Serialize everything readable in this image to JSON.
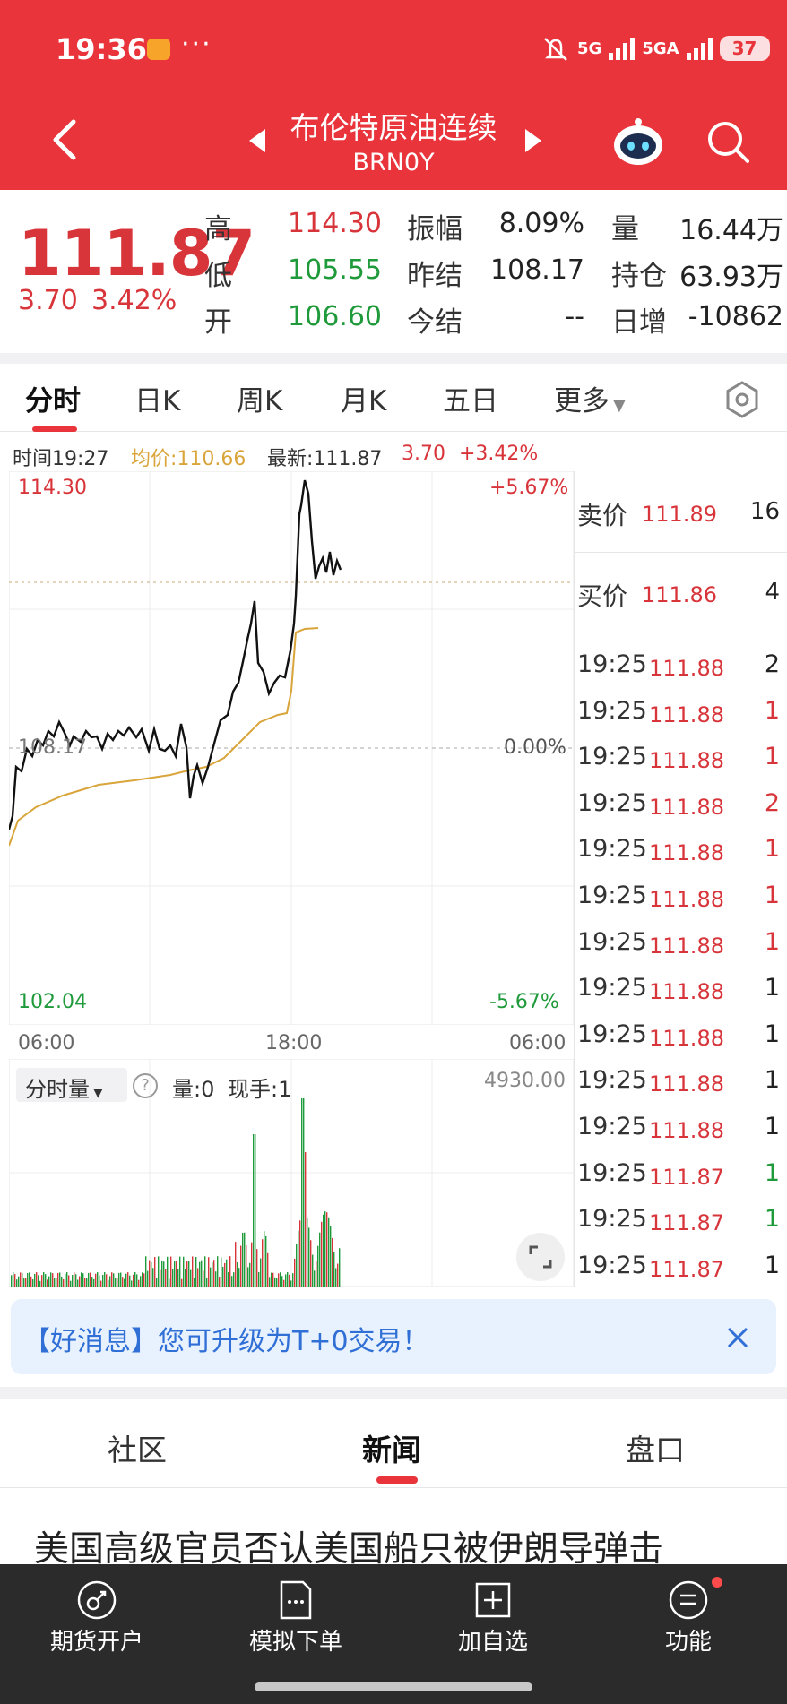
{
  "status_bar": {
    "time": "19:36",
    "dots": "···",
    "net1": "5G",
    "net2": "5GA",
    "battery": "37"
  },
  "header": {
    "title": "布伦特原油连续",
    "code": "BRN0Y"
  },
  "quote": {
    "last": "111.87",
    "change": "3.70",
    "change_pct": "3.42%",
    "high_label": "高",
    "high": "114.30",
    "low_label": "低",
    "low": "105.55",
    "open_label": "开",
    "open": "106.60",
    "amp_label": "振幅",
    "amp": "8.09%",
    "prev_label": "昨结",
    "prev": "108.17",
    "today_label": "今结",
    "today": "--",
    "vol_label": "量",
    "vol": "16.44万",
    "oi_label": "持仓",
    "oi": "63.93万",
    "inc_label": "日增",
    "inc": "-10862"
  },
  "tabs": [
    "分时",
    "日K",
    "周K",
    "月K",
    "五日",
    "更多"
  ],
  "info": {
    "time": "时间19:27",
    "avg": "均价:110.66",
    "latest": "最新:111.87",
    "chg": "3.70",
    "pct": "+3.42%"
  },
  "chart": {
    "top_price": "114.30",
    "mid_price": "108.17",
    "bottom_price": "102.04",
    "top_pct": "+5.67%",
    "mid_pct": "0.00%",
    "bottom_pct": "-5.67%",
    "time_labels": [
      "06:00",
      "18:00",
      "06:00"
    ],
    "vol_selector": "分时量",
    "help": "?",
    "vol_qty": "量:0",
    "vol_curr": "现手:1",
    "vol_max": "4930.00"
  },
  "order_book": {
    "ask_label": "卖价",
    "ask_price": "111.89",
    "ask_vol": "16",
    "bid_label": "买价",
    "bid_price": "111.86",
    "bid_vol": "4",
    "trades": [
      {
        "time": "19:25",
        "price": "111.88",
        "vol": "2",
        "color": "dark"
      },
      {
        "time": "19:25",
        "price": "111.88",
        "vol": "1",
        "color": "red"
      },
      {
        "time": "19:25",
        "price": "111.88",
        "vol": "1",
        "color": "red"
      },
      {
        "time": "19:25",
        "price": "111.88",
        "vol": "2",
        "color": "red"
      },
      {
        "time": "19:25",
        "price": "111.88",
        "vol": "1",
        "color": "red"
      },
      {
        "time": "19:25",
        "price": "111.88",
        "vol": "1",
        "color": "red"
      },
      {
        "time": "19:25",
        "price": "111.88",
        "vol": "1",
        "color": "red"
      },
      {
        "time": "19:25",
        "price": "111.88",
        "vol": "1",
        "color": "dark"
      },
      {
        "time": "19:25",
        "price": "111.88",
        "vol": "1",
        "color": "dark"
      },
      {
        "time": "19:25",
        "price": "111.88",
        "vol": "1",
        "color": "dark"
      },
      {
        "time": "19:25",
        "price": "111.88",
        "vol": "1",
        "color": "dark"
      },
      {
        "time": "19:25",
        "price": "111.87",
        "vol": "1",
        "color": "green"
      },
      {
        "time": "19:25",
        "price": "111.87",
        "vol": "1",
        "color": "green"
      },
      {
        "time": "19:25",
        "price": "111.87",
        "vol": "1",
        "color": "dark"
      }
    ]
  },
  "banner": {
    "text": "【好消息】您可升级为T+0交易！"
  },
  "lower_tabs": [
    "社区",
    "新闻",
    "盘口"
  ],
  "headline": "美国高级官员否认美国船只被伊朗导弹击",
  "bottom_nav": [
    {
      "label": "期货开户",
      "icon": "futures-account-icon"
    },
    {
      "label": "模拟下单",
      "icon": "simulated-order-icon"
    },
    {
      "label": "加自选",
      "icon": "add-watchlist-icon"
    },
    {
      "label": "功能",
      "icon": "menu-icon"
    }
  ],
  "colors": {
    "brand_red": "#e8343a",
    "up_red": "#d8353b",
    "down_green": "#1e9a3a",
    "avg_line": "#d9a53a",
    "banner_blue": "#2f6fd6"
  }
}
